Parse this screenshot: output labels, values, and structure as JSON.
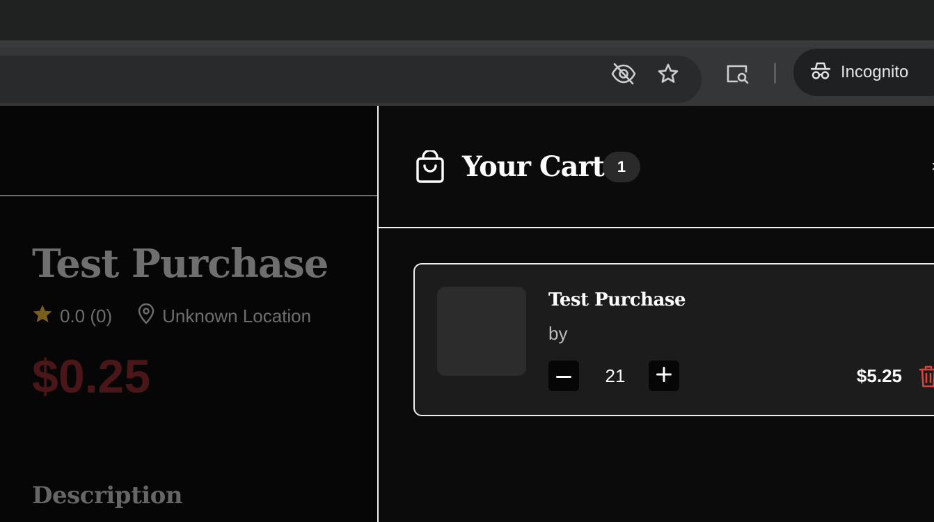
{
  "browser": {
    "incognito_label": "Incognito",
    "icons": [
      "eye-slash-icon",
      "star-icon",
      "lens-search-icon",
      "incognito-icon"
    ]
  },
  "product": {
    "title": "Test Purchase",
    "rating": "0.0 (0)",
    "location": "Unknown Location",
    "price": "$0.25",
    "description_heading": "Description",
    "star_color": "#7a5e1c",
    "price_color": "#4a1618"
  },
  "cart": {
    "title": "Your Cart",
    "count": "1",
    "close_glyph": "×",
    "items": [
      {
        "name": "Test Purchase",
        "byline": "by",
        "quantity": "21",
        "price": "$5.25",
        "delete_color": "#d9443f"
      }
    ]
  }
}
